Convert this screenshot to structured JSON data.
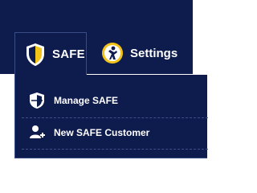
{
  "nav": {
    "tabs": [
      {
        "label": "SAFE",
        "icon": "shield-icon",
        "active": true
      },
      {
        "label": "Settings",
        "icon": "settings-badge-icon",
        "active": false
      }
    ]
  },
  "dropdown": {
    "items": [
      {
        "label": "Manage SAFE",
        "icon": "shield-half-icon"
      },
      {
        "label": "New SAFE Customer",
        "icon": "add-user-icon"
      }
    ]
  },
  "colors": {
    "nav_background": "#0e1b4d",
    "border": "#3a4c86",
    "shield_gold": "#f2c318",
    "text": "#ffffff"
  }
}
